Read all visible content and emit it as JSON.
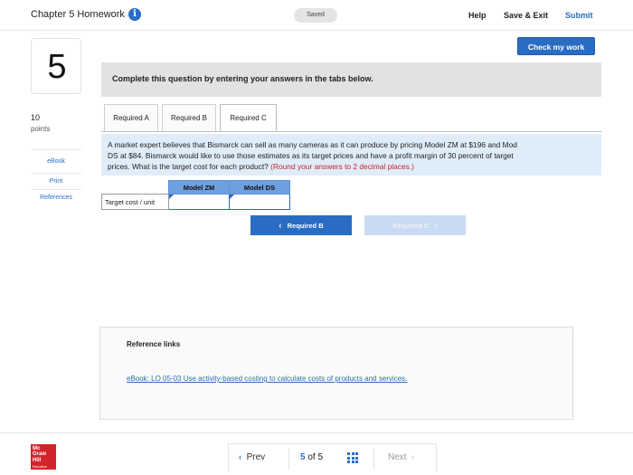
{
  "header": {
    "title": "Chapter 5 Homework",
    "info_icon": "info-icon",
    "saved": "Saved",
    "help": "Help",
    "save_exit": "Save & Exit",
    "submit": "Submit"
  },
  "question": {
    "number": "5",
    "points_value": "10",
    "points_label": "points"
  },
  "sidebar": {
    "items": [
      {
        "label": "eBook"
      },
      {
        "label": "Print"
      },
      {
        "label": "References"
      }
    ]
  },
  "check_work": "Check my work",
  "instruction": "Complete this question by entering your answers in the tabs below.",
  "tabs": [
    {
      "label": "Required A"
    },
    {
      "label": "Required B"
    },
    {
      "label": "Required C",
      "active": true
    }
  ],
  "prompt": {
    "line1": "A market expert believes that Bismarck can sell as many cameras as it can produce by pricing Model ZM at $196 and Mod",
    "line2": "DS at $84. Bismarck would like to use those estimates as its target prices and have a profit margin of 30 percent of target",
    "line3": "prices. What is the target cost for each product?",
    "hint": "(Round your answers to 2 decimal places.)"
  },
  "table": {
    "columns": [
      "Model ZM",
      "Model DS"
    ],
    "row_label": "Target cost / unit",
    "values": [
      "",
      ""
    ]
  },
  "nav": {
    "prev_label": "Required B",
    "next_label": "Required C"
  },
  "references": {
    "title": "Reference links",
    "link": "eBook: LO 05-03 Use activity-based costing to calculate costs of products and services."
  },
  "footer": {
    "logo_lines": [
      "Mc",
      "Graw",
      "Hill"
    ],
    "logo_sub": "Education",
    "prev": "Prev",
    "current": "5",
    "of": "of",
    "total": "5",
    "next": "Next"
  },
  "colors": {
    "accent": "#2a6cc4",
    "hint_red": "#c6202f",
    "table_header": "#6e9fde",
    "prompt_bg": "#dfedf9"
  }
}
